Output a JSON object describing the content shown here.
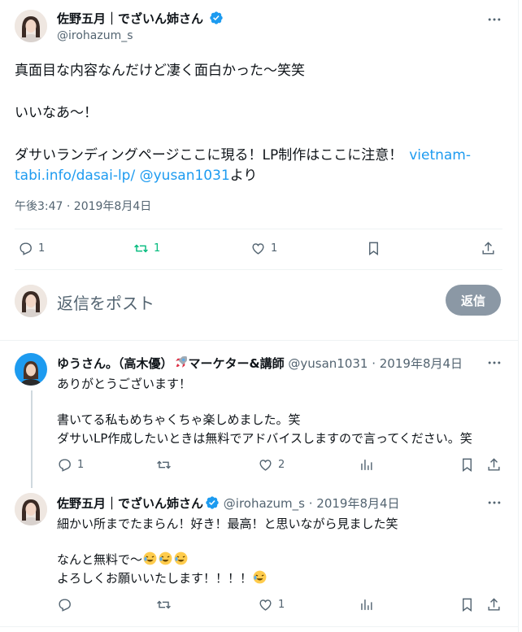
{
  "main_tweet": {
    "display_name": "佐野五月｜でざいん姉さん",
    "handle": "@irohazum_s",
    "line1": "真面目な内容なんだけど凄く面白かった〜笑笑",
    "line2": "いいなあ〜！",
    "line3_a": "ダサいランディングページここに現る！LP制作はここに注意！",
    "line3_link": "vietnam-",
    "line4_link": "tabi.info/dasai-lp/",
    "line4_mention": "@yusan1031",
    "line4_tail": "より",
    "timestamp": "午後3:47 · 2019年8月4日",
    "reply_count": "1",
    "retweet_count": "1",
    "like_count": "1"
  },
  "compose": {
    "placeholder": "返信をポスト",
    "button_label": "返信"
  },
  "reply1": {
    "display_name": "ゆうさん。（高木優）🚀マーケター&講師",
    "meta": "@yusan1031 · 2019年8月4日",
    "line1": "ありがとうございます！",
    "line2": "書いてる私もめちゃくちゃ楽しめました。笑",
    "line3": "ダサいLP作成したいときは無料でアドバイスしますので言ってください。笑",
    "reply_count": "1",
    "like_count": "2"
  },
  "reply2": {
    "display_name": "佐野五月｜でざいん姉さん",
    "meta": "@irohazum_s · 2019年8月4日",
    "line1": "細かい所までたまらん！好き！最高！と思いながら見ました笑",
    "line2": "なんと無料で〜",
    "line3": "よろしくお願いいたします！！！！",
    "like_count": "1"
  },
  "colors": {
    "accent": "#1d9bf0",
    "retweet_green": "#00ba7c",
    "muted": "#536471",
    "button_disabled": "#8b98a5"
  },
  "icons": [
    "verified-badge-icon",
    "more-icon",
    "reply-icon",
    "retweet-icon",
    "like-icon",
    "bookmark-icon",
    "share-icon",
    "views-icon",
    "rocket-emoji-icon",
    "rofl-emoji-icon"
  ]
}
